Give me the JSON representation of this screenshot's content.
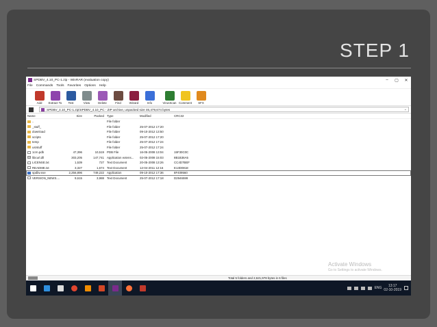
{
  "slide": {
    "title": "STEP 1"
  },
  "window": {
    "title": "SPDBV_4.10_PC-1.zip - WinRAR (evaluation copy)",
    "controls": [
      "–",
      "▢",
      "✕"
    ]
  },
  "menu": [
    "File",
    "Commands",
    "Tools",
    "Favorites",
    "Options",
    "Help"
  ],
  "toolbar": [
    {
      "label": "Add",
      "icon": "add-icon",
      "color": "#c0392b"
    },
    {
      "label": "Extract To",
      "icon": "extract-icon",
      "color": "#8e44ad"
    },
    {
      "label": "Test",
      "icon": "test-icon",
      "color": "#2c5aa0"
    },
    {
      "label": "View",
      "icon": "view-icon",
      "color": "#7f8c8d"
    },
    {
      "label": "Delete",
      "icon": "delete-icon",
      "color": "#9b59b6"
    },
    {
      "label": "Find",
      "icon": "find-icon",
      "color": "#6d4c41"
    },
    {
      "label": "Wizard",
      "icon": "wizard-icon",
      "color": "#8b1e3f"
    },
    {
      "label": "Info",
      "icon": "info-icon",
      "color": "#3b6fd8"
    },
    {
      "label": "VirusScan",
      "icon": "virusscan-icon",
      "color": "#2e7d32"
    },
    {
      "label": "Comment",
      "icon": "comment-icon",
      "color": "#f0c420"
    },
    {
      "label": "SFX",
      "icon": "sfx-icon",
      "color": "#e08a1e"
    }
  ],
  "path": "SPDBV_4.10_PC-1.zip\\SPDBV_4.10_PC - ZIP archive, unpacked size 46,479,674 bytes",
  "columns": {
    "name": "Name",
    "size": "Size",
    "packed": "Packed",
    "type": "Type",
    "modified": "Modified",
    "crc": "CRC32"
  },
  "files": [
    {
      "name": "..",
      "size": "",
      "packed": "",
      "type": "File folder",
      "modified": "",
      "crc": "",
      "kind": "folder"
    },
    {
      "name": "_stuff_",
      "size": "",
      "packed": "",
      "type": "File folder",
      "modified": "25-07-2012 17:20",
      "crc": "",
      "kind": "folder"
    },
    {
      "name": "download",
      "size": "",
      "packed": "",
      "type": "File folder",
      "modified": "09-10-2012 13:50",
      "crc": "",
      "kind": "folder"
    },
    {
      "name": "scripts",
      "size": "",
      "packed": "",
      "type": "File folder",
      "modified": "25-07-2012 17:20",
      "crc": "",
      "kind": "folder"
    },
    {
      "name": "temp",
      "size": "",
      "packed": "",
      "type": "File folder",
      "modified": "25-07-2012 17:24",
      "crc": "",
      "kind": "folder"
    },
    {
      "name": "usrstuff",
      "size": "",
      "packed": "",
      "type": "File folder",
      "modified": "25-07-2012 17:24",
      "crc": "",
      "kind": "folder"
    },
    {
      "name": "1crn.pdb",
      "size": "47,396",
      "packed": "10,519",
      "type": "PDB File",
      "modified": "16-05-2008 13:04",
      "crc": "15F30C0C",
      "kind": "file"
    },
    {
      "name": "libcurl.dll",
      "size": "303,205",
      "packed": "147,741",
      "type": "Application extens...",
      "modified": "02-05-2008 15:03",
      "crc": "8B1B36A5",
      "kind": "dll"
    },
    {
      "name": "LICENSE.txt",
      "size": "1,539",
      "packed": "727",
      "type": "Text Document",
      "modified": "20-05-2008 13:26",
      "crc": "CC4D7BEF",
      "kind": "file"
    },
    {
      "name": "README.txt",
      "size": "3,327",
      "packed": "1,674",
      "type": "Text Document",
      "modified": "12-04-2011 12:16",
      "crc": "E13D0818",
      "kind": "file"
    },
    {
      "name": "spdbv.exe",
      "size": "2,256,896",
      "packed": "749,222",
      "type": "Application",
      "modified": "09-10-2012 17:36",
      "crc": "8F409560",
      "kind": "exe",
      "selected": true
    },
    {
      "name": "VERSION_NEWS....",
      "size": "9,615",
      "packed": "3,988",
      "type": "Text Document",
      "modified": "25-07-2012 17:18",
      "crc": "D2946599",
      "kind": "file"
    }
  ],
  "watermark": {
    "line1": "Activate Windows",
    "line2": "Go to Settings to activate Windows."
  },
  "status": "Total 5 folders and 2,621,978 bytes in 6 files",
  "taskbar": {
    "apps": [
      {
        "icon": "start-icon",
        "color": "#ffffff"
      },
      {
        "icon": "edge-icon",
        "color": "#2f8fde"
      },
      {
        "icon": "store-icon",
        "color": "#dddddd"
      },
      {
        "icon": "chrome-icon",
        "color": "#e0452f"
      },
      {
        "icon": "vlc-icon",
        "color": "#f08c00"
      },
      {
        "icon": "powerpoint-icon",
        "color": "#d24726"
      },
      {
        "icon": "winrar-icon",
        "color": "#7a2b8c"
      },
      {
        "icon": "firefox-icon",
        "color": "#ff7139"
      },
      {
        "icon": "window-icon",
        "color": "#c0392b"
      }
    ],
    "language": "ENG",
    "time": "13:17",
    "date": "02-10-2019"
  }
}
